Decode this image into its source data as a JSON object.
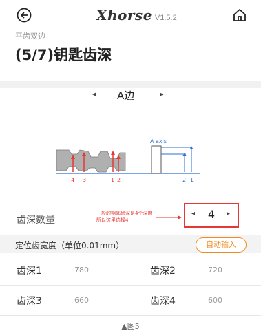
{
  "header": {
    "brand": "Xhorse",
    "version": "V1.5.2",
    "subtitle": "平齿双边",
    "title": "(5/7)钥匙齿深"
  },
  "side_selector": {
    "prev": "◂",
    "label": "A边",
    "next": "▸"
  },
  "diagram": {
    "axis_label": "A axis",
    "cut_numbers": [
      "4",
      "3",
      "1",
      "2"
    ],
    "axis_numbers": [
      "2",
      "1"
    ],
    "colors": {
      "cut_arrow": "#e53935",
      "axis": "#2f6fd6",
      "key": "#9e9e9e"
    }
  },
  "depth_count": {
    "label": "齿深数量",
    "hint_line1": "一般的钥匙齿深是4个深度",
    "hint_line2": "所以这里选择4",
    "value": "4",
    "dec": "◂",
    "inc": "▸"
  },
  "section": {
    "label": "定位齿宽度（单位0.01mm）",
    "auto_button": "自动输入"
  },
  "depths": [
    {
      "name": "齿深1",
      "value": "780"
    },
    {
      "name": "齿深2",
      "value": "720"
    },
    {
      "name": "齿深3",
      "value": "660"
    },
    {
      "name": "齿深4",
      "value": "600"
    }
  ],
  "caption": "▲图5",
  "colors": {
    "accent": "#ef8a1f",
    "highlight": "#e53935"
  }
}
